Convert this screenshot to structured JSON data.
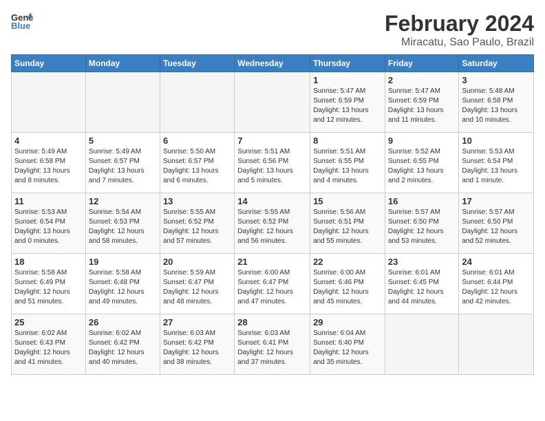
{
  "header": {
    "logo_line1": "General",
    "logo_line2": "Blue",
    "month_year": "February 2024",
    "location": "Miracatu, Sao Paulo, Brazil"
  },
  "days_of_week": [
    "Sunday",
    "Monday",
    "Tuesday",
    "Wednesday",
    "Thursday",
    "Friday",
    "Saturday"
  ],
  "weeks": [
    [
      {
        "day": "",
        "info": ""
      },
      {
        "day": "",
        "info": ""
      },
      {
        "day": "",
        "info": ""
      },
      {
        "day": "",
        "info": ""
      },
      {
        "day": "1",
        "info": "Sunrise: 5:47 AM\nSunset: 6:59 PM\nDaylight: 13 hours\nand 12 minutes."
      },
      {
        "day": "2",
        "info": "Sunrise: 5:47 AM\nSunset: 6:59 PM\nDaylight: 13 hours\nand 11 minutes."
      },
      {
        "day": "3",
        "info": "Sunrise: 5:48 AM\nSunset: 6:58 PM\nDaylight: 13 hours\nand 10 minutes."
      }
    ],
    [
      {
        "day": "4",
        "info": "Sunrise: 5:49 AM\nSunset: 6:58 PM\nDaylight: 13 hours\nand 8 minutes."
      },
      {
        "day": "5",
        "info": "Sunrise: 5:49 AM\nSunset: 6:57 PM\nDaylight: 13 hours\nand 7 minutes."
      },
      {
        "day": "6",
        "info": "Sunrise: 5:50 AM\nSunset: 6:57 PM\nDaylight: 13 hours\nand 6 minutes."
      },
      {
        "day": "7",
        "info": "Sunrise: 5:51 AM\nSunset: 6:56 PM\nDaylight: 13 hours\nand 5 minutes."
      },
      {
        "day": "8",
        "info": "Sunrise: 5:51 AM\nSunset: 6:55 PM\nDaylight: 13 hours\nand 4 minutes."
      },
      {
        "day": "9",
        "info": "Sunrise: 5:52 AM\nSunset: 6:55 PM\nDaylight: 13 hours\nand 2 minutes."
      },
      {
        "day": "10",
        "info": "Sunrise: 5:53 AM\nSunset: 6:54 PM\nDaylight: 13 hours\nand 1 minute."
      }
    ],
    [
      {
        "day": "11",
        "info": "Sunrise: 5:53 AM\nSunset: 6:54 PM\nDaylight: 13 hours\nand 0 minutes."
      },
      {
        "day": "12",
        "info": "Sunrise: 5:54 AM\nSunset: 6:53 PM\nDaylight: 12 hours\nand 58 minutes."
      },
      {
        "day": "13",
        "info": "Sunrise: 5:55 AM\nSunset: 6:52 PM\nDaylight: 12 hours\nand 57 minutes."
      },
      {
        "day": "14",
        "info": "Sunrise: 5:55 AM\nSunset: 6:52 PM\nDaylight: 12 hours\nand 56 minutes."
      },
      {
        "day": "15",
        "info": "Sunrise: 5:56 AM\nSunset: 6:51 PM\nDaylight: 12 hours\nand 55 minutes."
      },
      {
        "day": "16",
        "info": "Sunrise: 5:57 AM\nSunset: 6:50 PM\nDaylight: 12 hours\nand 53 minutes."
      },
      {
        "day": "17",
        "info": "Sunrise: 5:57 AM\nSunset: 6:50 PM\nDaylight: 12 hours\nand 52 minutes."
      }
    ],
    [
      {
        "day": "18",
        "info": "Sunrise: 5:58 AM\nSunset: 6:49 PM\nDaylight: 12 hours\nand 51 minutes."
      },
      {
        "day": "19",
        "info": "Sunrise: 5:58 AM\nSunset: 6:48 PM\nDaylight: 12 hours\nand 49 minutes."
      },
      {
        "day": "20",
        "info": "Sunrise: 5:59 AM\nSunset: 6:47 PM\nDaylight: 12 hours\nand 48 minutes."
      },
      {
        "day": "21",
        "info": "Sunrise: 6:00 AM\nSunset: 6:47 PM\nDaylight: 12 hours\nand 47 minutes."
      },
      {
        "day": "22",
        "info": "Sunrise: 6:00 AM\nSunset: 6:46 PM\nDaylight: 12 hours\nand 45 minutes."
      },
      {
        "day": "23",
        "info": "Sunrise: 6:01 AM\nSunset: 6:45 PM\nDaylight: 12 hours\nand 44 minutes."
      },
      {
        "day": "24",
        "info": "Sunrise: 6:01 AM\nSunset: 6:44 PM\nDaylight: 12 hours\nand 42 minutes."
      }
    ],
    [
      {
        "day": "25",
        "info": "Sunrise: 6:02 AM\nSunset: 6:43 PM\nDaylight: 12 hours\nand 41 minutes."
      },
      {
        "day": "26",
        "info": "Sunrise: 6:02 AM\nSunset: 6:42 PM\nDaylight: 12 hours\nand 40 minutes."
      },
      {
        "day": "27",
        "info": "Sunrise: 6:03 AM\nSunset: 6:42 PM\nDaylight: 12 hours\nand 38 minutes."
      },
      {
        "day": "28",
        "info": "Sunrise: 6:03 AM\nSunset: 6:41 PM\nDaylight: 12 hours\nand 37 minutes."
      },
      {
        "day": "29",
        "info": "Sunrise: 6:04 AM\nSunset: 6:40 PM\nDaylight: 12 hours\nand 35 minutes."
      },
      {
        "day": "",
        "info": ""
      },
      {
        "day": "",
        "info": ""
      }
    ]
  ]
}
